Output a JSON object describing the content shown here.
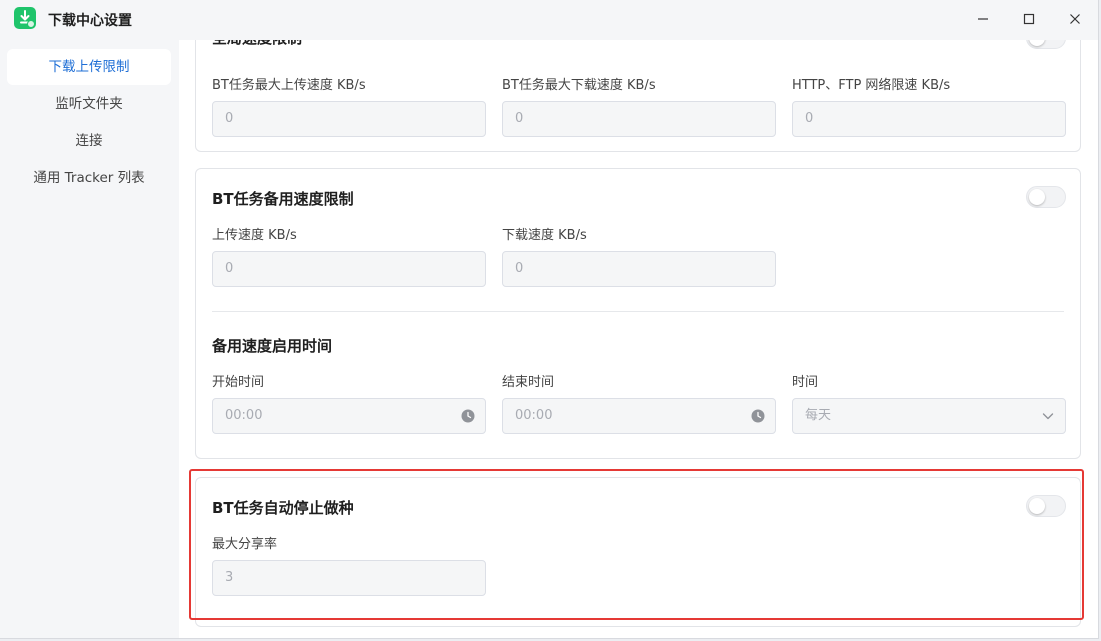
{
  "window": {
    "title": "下载中心设置",
    "controls": [
      "minimize-icon",
      "maximize-icon",
      "close-icon"
    ]
  },
  "sidebar": {
    "items": [
      {
        "label": "下载上传限制",
        "active": true
      },
      {
        "label": "监听文件夹",
        "active": false
      },
      {
        "label": "连接",
        "active": false
      },
      {
        "label": "通用 Tracker 列表",
        "active": false
      }
    ]
  },
  "section_global": {
    "title_partial": "全局速度限制",
    "labels": [
      "BT任务最大上传速度 KB/s",
      "BT任务最大下载速度 KB/s",
      "HTTP、FTP 网络限速 KB/s"
    ],
    "placeholders": [
      "0",
      "0",
      "0"
    ],
    "toggle_on": false
  },
  "section_backup": {
    "title": "BT任务备用速度限制",
    "toggle_on": false,
    "labels": [
      "上传速度 KB/s",
      "下载速度 KB/s"
    ],
    "placeholders": [
      "0",
      "0"
    ],
    "schedule_title": "备用速度启用时间",
    "schedule_labels": [
      "开始时间",
      "结束时间",
      "时间"
    ],
    "start_time": "00:00",
    "end_time": "00:00",
    "frequency": "每天"
  },
  "section_seeding": {
    "title": "BT任务自动停止做种",
    "toggle_on": false,
    "label": "最大分享率",
    "placeholder": "3"
  },
  "colors": {
    "accent": "#1f6fd6",
    "app_icon": "#1fc46b",
    "highlight": "#e53935"
  }
}
